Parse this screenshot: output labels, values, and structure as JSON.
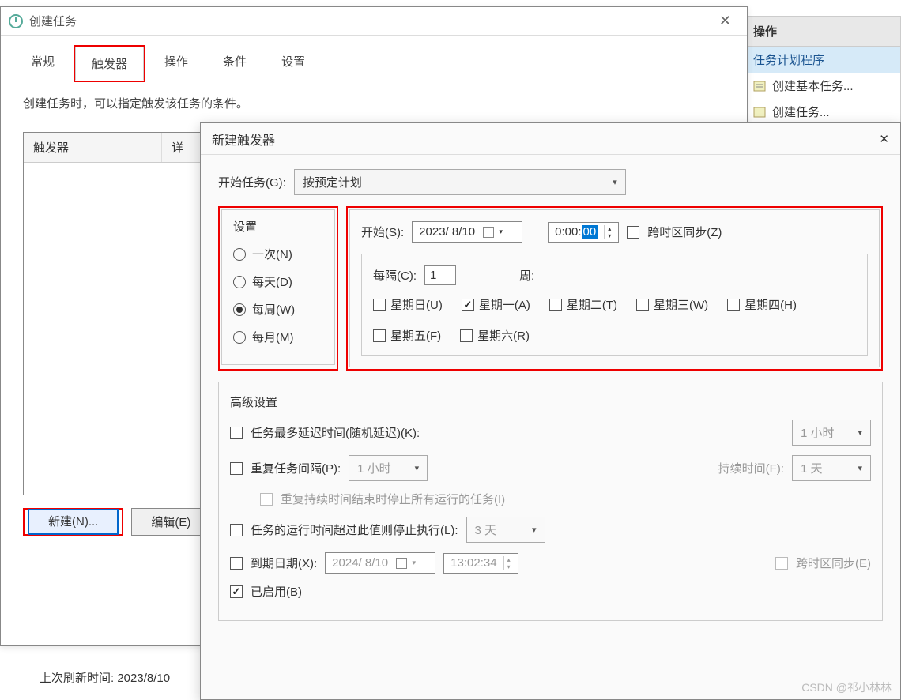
{
  "bg": {
    "header": "操作",
    "sub": "任务计划程序",
    "item1": "创建基本任务...",
    "item2": "创建任务..."
  },
  "win1": {
    "title": "创建任务",
    "tabs": {
      "general": "常规",
      "triggers": "触发器",
      "actions": "操作",
      "conditions": "条件",
      "settings": "设置"
    },
    "desc": "创建任务时，可以指定触发该任务的条件。",
    "th_trigger": "触发器",
    "th_detail": "详",
    "btn_new": "新建(N)...",
    "btn_edit": "编辑(E)",
    "lastrefresh": "上次刷新时间: 2023/8/10"
  },
  "win2": {
    "title": "新建触发器",
    "start_task_label": "开始任务(G):",
    "start_task_value": "按预定计划",
    "settings_legend": "设置",
    "radio_once": "一次(N)",
    "radio_daily": "每天(D)",
    "radio_weekly": "每周(W)",
    "radio_monthly": "每月(M)",
    "start_label": "开始(S):",
    "start_date": "2023/ 8/10",
    "start_time_prefix": "0:00:",
    "start_time_sel": "00",
    "tz_sync": "跨时区同步(Z)",
    "interval_label": "每隔(C):",
    "interval_value": "1",
    "interval_unit": "周:",
    "day_sun": "星期日(U)",
    "day_mon": "星期一(A)",
    "day_tue": "星期二(T)",
    "day_wed": "星期三(W)",
    "day_thu": "星期四(H)",
    "day_fri": "星期五(F)",
    "day_sat": "星期六(R)",
    "adv_legend": "高级设置",
    "adv_delay": "任务最多延迟时间(随机延迟)(K):",
    "adv_delay_val": "1 小时",
    "adv_repeat": "重复任务间隔(P):",
    "adv_repeat_val": "1 小时",
    "adv_duration_label": "持续时间(F):",
    "adv_duration_val": "1 天",
    "adv_stop_after": "重复持续时间结束时停止所有运行的任务(I)",
    "adv_stop_limit": "任务的运行时间超过此值则停止执行(L):",
    "adv_stop_limit_val": "3 天",
    "adv_expire": "到期日期(X):",
    "adv_expire_date": "2024/ 8/10",
    "adv_expire_time": "13:02:34",
    "adv_expire_tz": "跨时区同步(E)",
    "adv_enabled": "已启用(B)"
  },
  "watermark": "CSDN @祁小林林"
}
